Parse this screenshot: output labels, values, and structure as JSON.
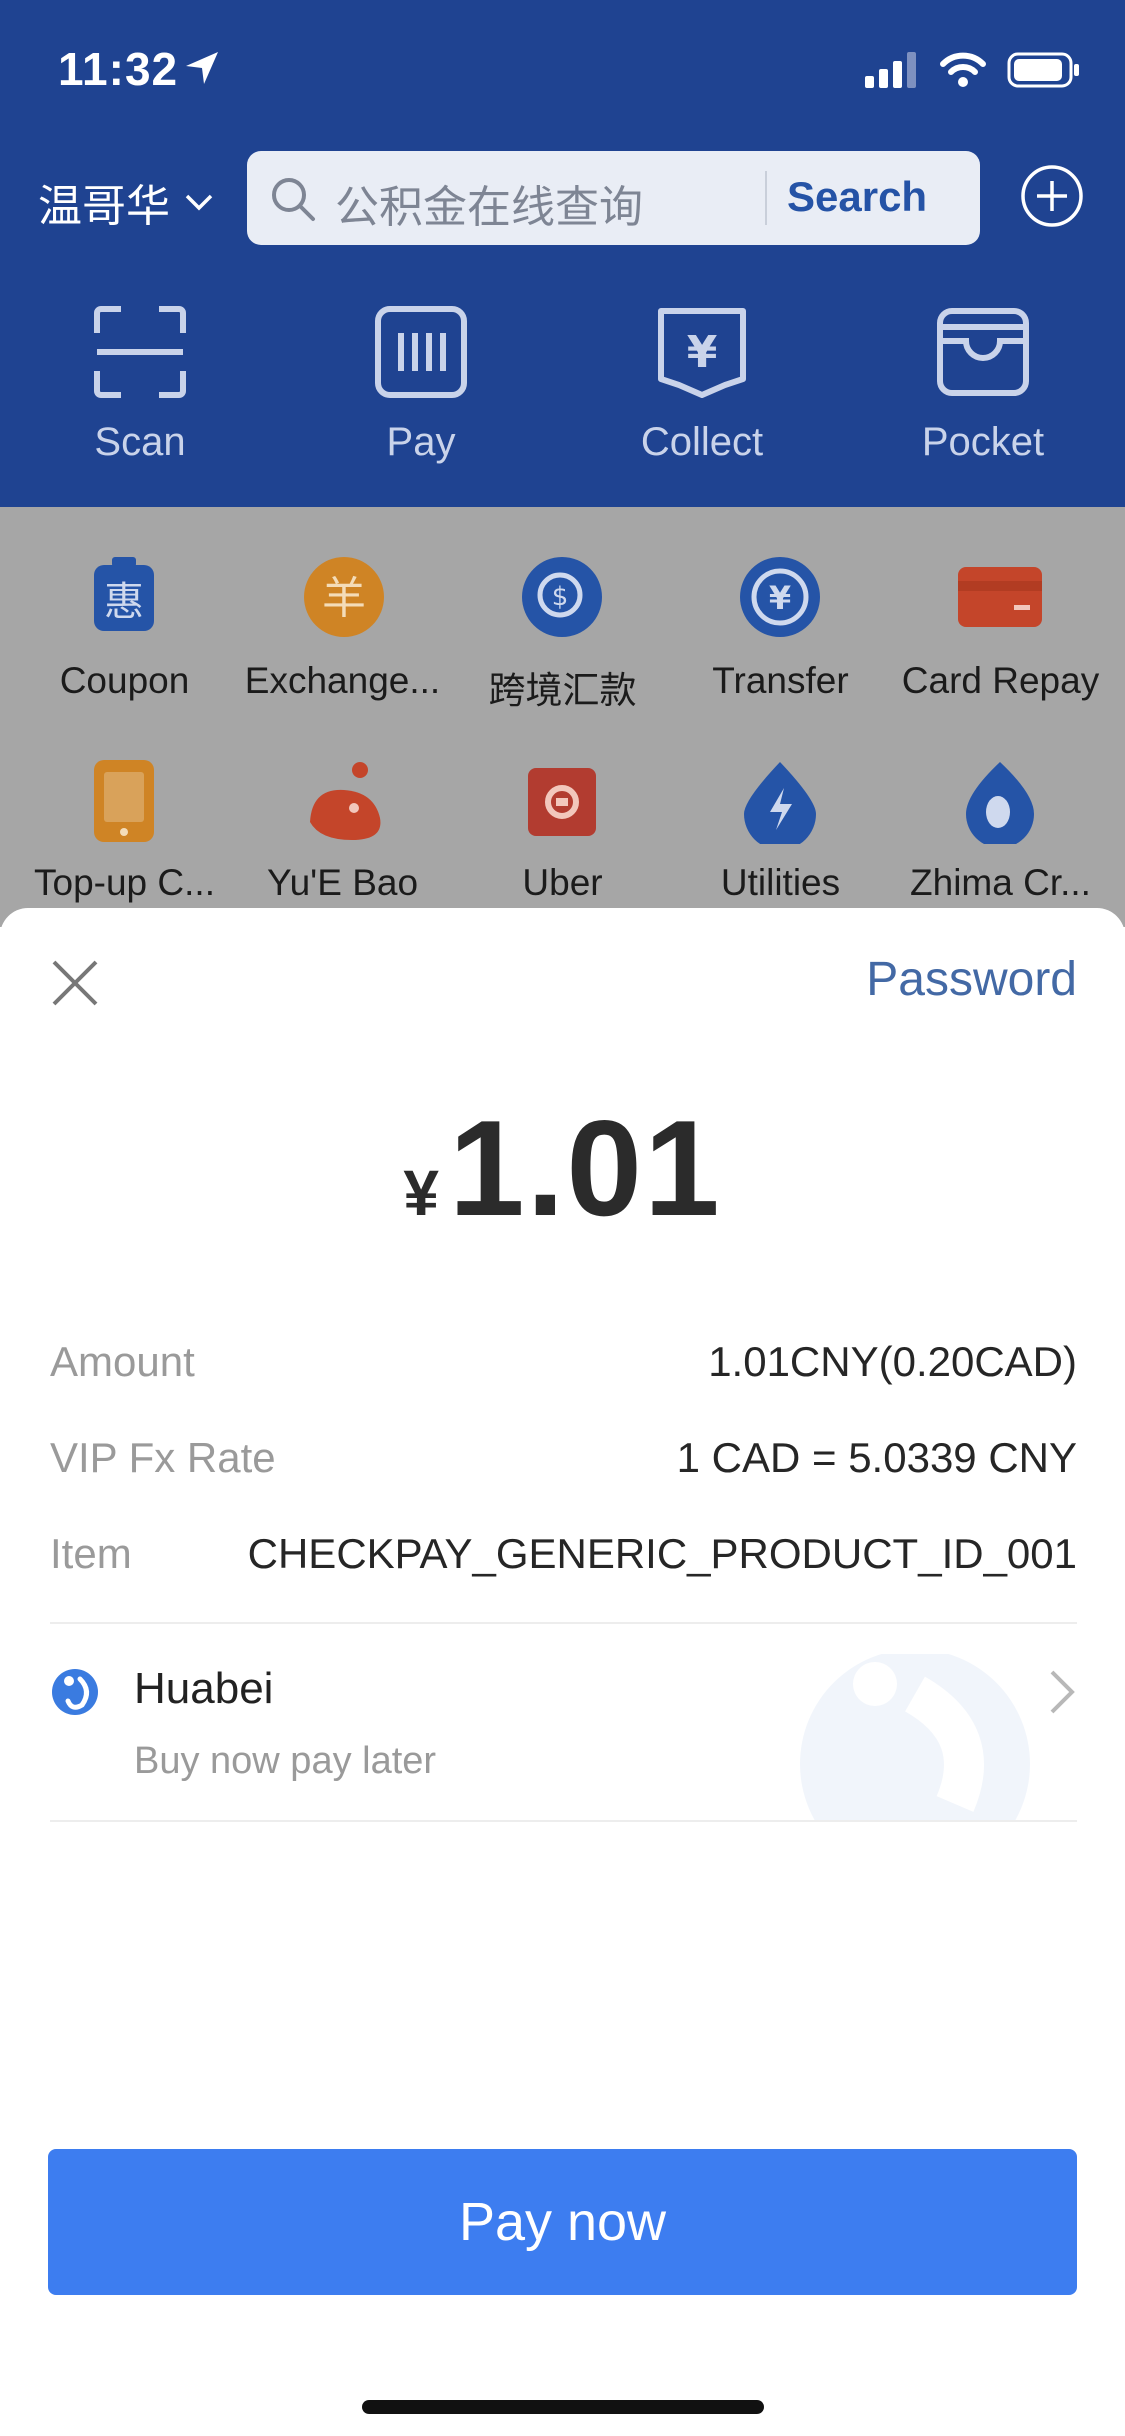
{
  "status_bar": {
    "time": "11:32"
  },
  "header": {
    "city": "温哥华",
    "search_placeholder": "公积金在线查询",
    "search_button": "Search",
    "quick_actions": [
      "Scan",
      "Pay",
      "Collect",
      "Pocket"
    ]
  },
  "grid": {
    "row1": [
      "Coupon",
      "Exchange...",
      "跨境汇款",
      "Transfer",
      "Card Repay"
    ],
    "row2": [
      "Top-up C...",
      "Yu'E Bao",
      "Uber",
      "Utilities",
      "Zhima Cr..."
    ]
  },
  "sheet": {
    "password_link": "Password",
    "currency_symbol": "¥",
    "amount": "1.01",
    "details": [
      {
        "label": "Amount",
        "value": "1.01CNY(0.20CAD)"
      },
      {
        "label": "VIP Fx Rate",
        "value": "1 CAD = 5.0339 CNY"
      },
      {
        "label": "Item",
        "value": "CHECKPAY_GENERIC_PRODUCT_ID_001"
      }
    ],
    "payment_method": {
      "name": "Huabei",
      "subtitle": "Buy now pay later"
    },
    "pay_button": "Pay now"
  },
  "colors": {
    "header_bg": "#1f4391",
    "accent": "#3d7df0",
    "link": "#4369a5"
  }
}
